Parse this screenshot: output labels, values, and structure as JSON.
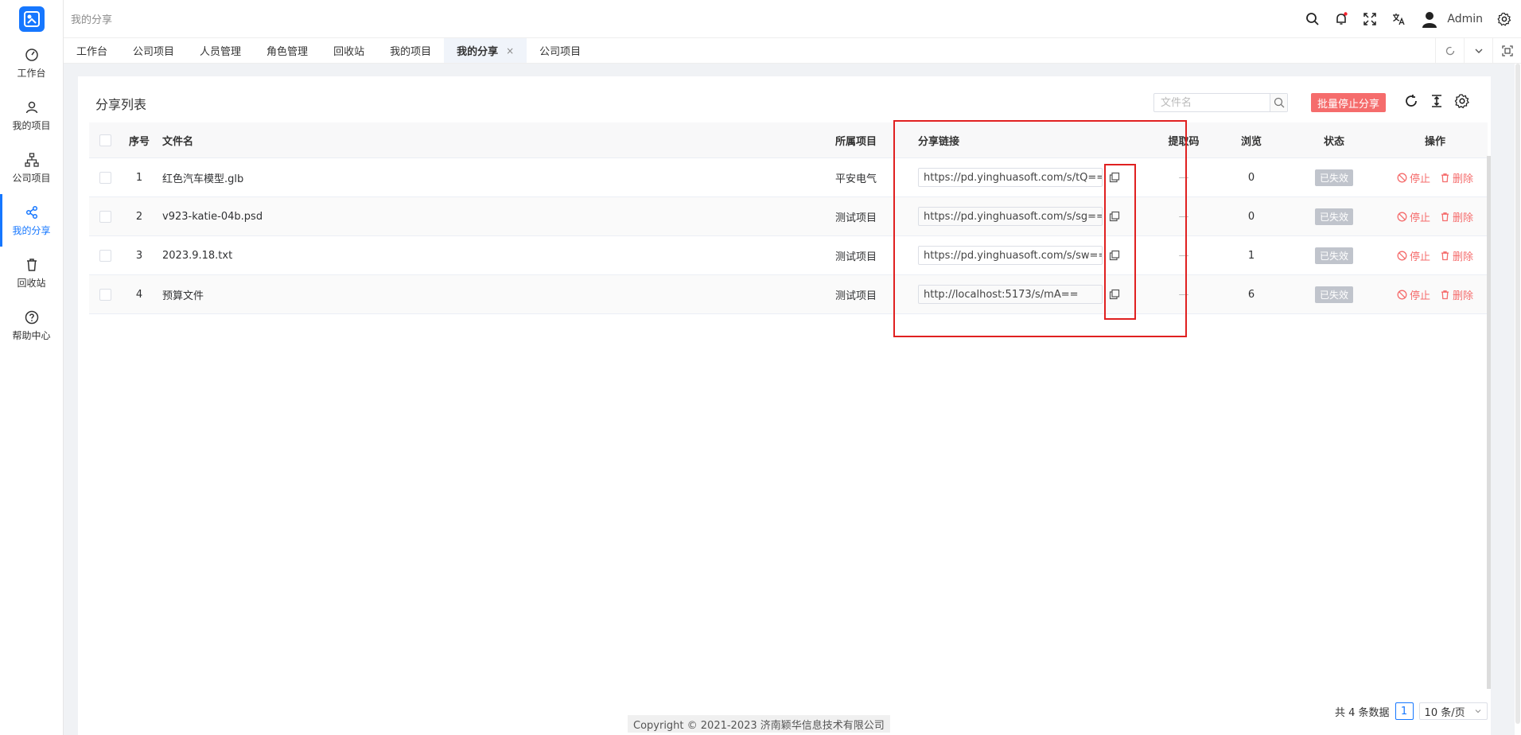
{
  "app": {
    "logo_icon": "share-logo",
    "brand_color": "#1677ff"
  },
  "sidebar": {
    "items": [
      {
        "label": "工作台",
        "icon": "dashboard-icon"
      },
      {
        "label": "我的项目",
        "icon": "user-icon"
      },
      {
        "label": "公司项目",
        "icon": "org-tree-icon"
      },
      {
        "label": "我的分享",
        "icon": "share-icon",
        "active": true
      },
      {
        "label": "回收站",
        "icon": "trash-icon"
      },
      {
        "label": "帮助中心",
        "icon": "help-icon"
      }
    ]
  },
  "header": {
    "breadcrumb": "我的分享",
    "user_name": "Admin"
  },
  "tabs": [
    {
      "label": "工作台"
    },
    {
      "label": "公司项目"
    },
    {
      "label": "人员管理"
    },
    {
      "label": "角色管理"
    },
    {
      "label": "回收站"
    },
    {
      "label": "我的项目"
    },
    {
      "label": "我的分享",
      "active": true,
      "close": "×"
    },
    {
      "label": "公司项目"
    }
  ],
  "main": {
    "title": "分享列表",
    "search": {
      "placeholder": "文件名",
      "value": ""
    },
    "batch_stop_label": "批量停止分享",
    "columns": {
      "index": "序号",
      "name": "文件名",
      "project": "所属项目",
      "link": "分享链接",
      "code": "提取码",
      "views": "浏览",
      "status": "状态",
      "actions": "操作"
    },
    "rows": [
      {
        "index": "1",
        "name": "红色汽车模型.glb",
        "project": "平安电气",
        "link": "https://pd.yinghuasoft.com/s/tQ==",
        "code": "—",
        "views": "0",
        "status": "已失效",
        "stop": "停止",
        "delete": "删除"
      },
      {
        "index": "2",
        "name": "v923-katie-04b.psd",
        "project": "测试项目",
        "link": "https://pd.yinghuasoft.com/s/sg==",
        "code": "—",
        "views": "0",
        "status": "已失效",
        "stop": "停止",
        "delete": "删除"
      },
      {
        "index": "3",
        "name": "2023.9.18.txt",
        "project": "测试项目",
        "link": "https://pd.yinghuasoft.com/s/sw==",
        "code": "—",
        "views": "1",
        "status": "已失效",
        "stop": "停止",
        "delete": "删除"
      },
      {
        "index": "4",
        "name": "预算文件",
        "project": "测试项目",
        "link": "http://localhost:5173/s/mA==",
        "code": "—",
        "views": "6",
        "status": "已失效",
        "stop": "停止",
        "delete": "删除"
      }
    ]
  },
  "pagination": {
    "total": "共 4 条数据",
    "current": "1",
    "page_size": "10 条/页"
  },
  "footer": {
    "copyright": "Copyright © 2021-2023 济南颖华信息技术有限公司"
  },
  "colors": {
    "danger": "#f56c6c",
    "highlight": "#e02020",
    "disabled_badge": "#c0c4cc"
  }
}
